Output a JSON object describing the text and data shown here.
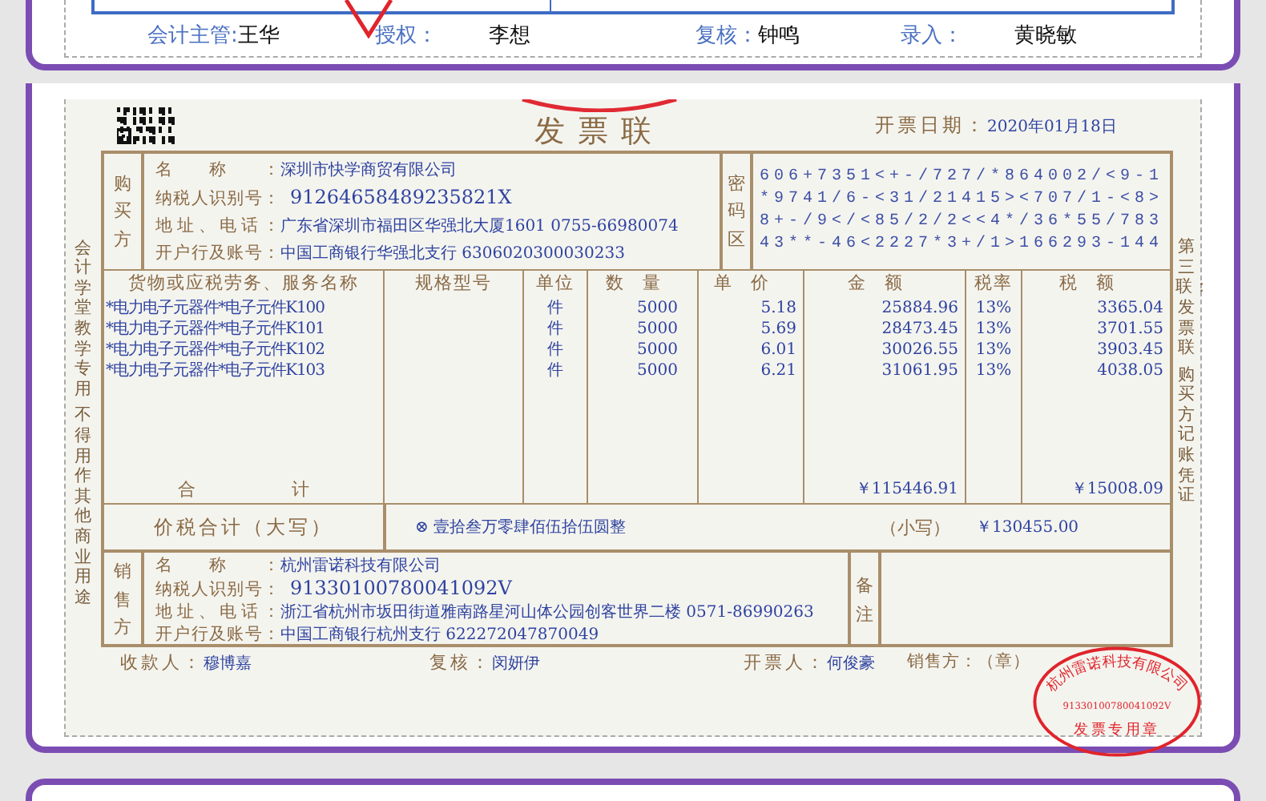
{
  "top_card": {
    "signatures": [
      {
        "label": "会计主管:",
        "name": "王华"
      },
      {
        "label": "授权：",
        "name": "李想"
      },
      {
        "label": "复核：",
        "name": "钟鸣"
      },
      {
        "label": "录入：",
        "name": "黄晓敏"
      }
    ]
  },
  "invoice": {
    "title": "发票联",
    "date_label": "开票日期：",
    "date": "2020年01月18日",
    "side_note_left": [
      "会计学堂教学专用",
      "不得用作其他商业用途"
    ],
    "side_note_right": [
      "第三联：发票联",
      "购买方记账凭证"
    ],
    "buyer": {
      "side_label": "购买方",
      "fields": [
        {
          "label": "名称：",
          "value": "深圳市快学商贸有限公司"
        },
        {
          "label": "纳税人识别号：",
          "value": "91264658489235821X"
        },
        {
          "label": "地址、电话：",
          "value": "广东省深圳市福田区华强北大厦1601 0755-66980074"
        },
        {
          "label": "开户行及账号：",
          "value": "中国工商银行华强北支行 6306020300030233"
        }
      ]
    },
    "cipher_label": "密码区",
    "cipher_lines": [
      "606+7351<+-/727/*864002/<9-1",
      "*9741/6-<31/21415><707/1-<8>",
      "8+-/9</<85/2/2<<4*/36*55/783",
      "43**-46<2227*3+/1>166293-144"
    ],
    "columns": [
      "货物或应税劳务、服务名称",
      "规格型号",
      "单位",
      "数量",
      "单价",
      "金额",
      "税率",
      "税额"
    ],
    "items": [
      {
        "name": "*电力电子元器件*电子元件K100",
        "unit": "件",
        "qty": "5000",
        "price": "5.18",
        "amount": "25884.96",
        "rate": "13%",
        "tax": "3365.04"
      },
      {
        "name": "*电力电子元器件*电子元件K101",
        "unit": "件",
        "qty": "5000",
        "price": "5.69",
        "amount": "28473.45",
        "rate": "13%",
        "tax": "3701.55"
      },
      {
        "name": "*电力电子元器件*电子元件K102",
        "unit": "件",
        "qty": "5000",
        "price": "6.01",
        "amount": "30026.55",
        "rate": "13%",
        "tax": "3903.45"
      },
      {
        "name": "*电力电子元器件*电子元件K103",
        "unit": "件",
        "qty": "5000",
        "price": "6.21",
        "amount": "31061.95",
        "rate": "13%",
        "tax": "4038.05"
      }
    ],
    "total_label": "合计",
    "total_amount": "￥115446.91",
    "total_tax": "￥15008.09",
    "words_label": "价税合计（大写）",
    "words_value": "⊗ 壹拾叁万零肆佰伍拾伍圆整",
    "small_label": "（小写）",
    "small_value": "￥130455.00",
    "seller": {
      "side_label": "销售方",
      "fields": [
        {
          "label": "名称：",
          "value": "杭州雷诺科技有限公司"
        },
        {
          "label": "纳税人识别号：",
          "value": "91330100780041092V"
        },
        {
          "label": "地址、电话：",
          "value": "浙江省杭州市坂田街道雅南路星河山体公园创客世界二楼 0571-86990263"
        },
        {
          "label": "开户行及账号：",
          "value": "中国工商银行杭州支行 622272047870049"
        }
      ]
    },
    "remark_label": "备注",
    "footer": [
      {
        "label": "收款人：",
        "value": "穆博嘉"
      },
      {
        "label": "复核：",
        "value": "闵妍伊"
      },
      {
        "label": "开票人：",
        "value": "何俊豪"
      }
    ],
    "seal_label": "销售方：（章）",
    "seal": {
      "ring_text": "杭州雷诺科技有限公司",
      "tax_id": "91330100780041092V",
      "bottom_text": "发票专用章"
    }
  }
}
